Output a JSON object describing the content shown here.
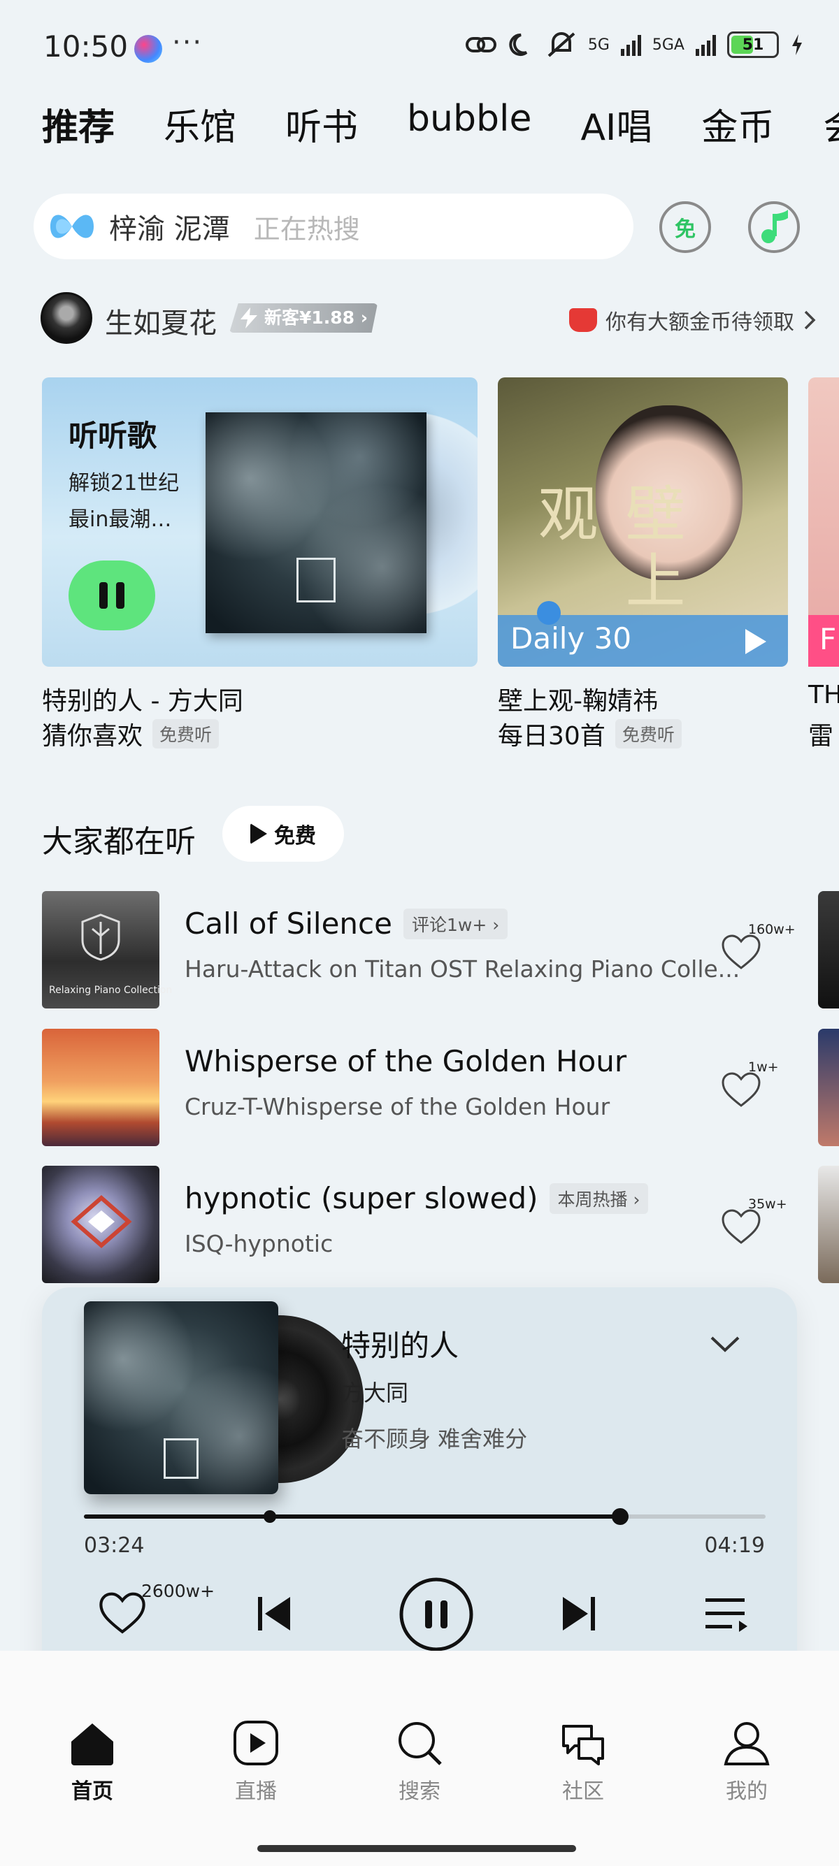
{
  "status_bar": {
    "time": "10:50",
    "dots": "···",
    "network1": "5G",
    "network2": "5GA",
    "battery": "51"
  },
  "tabs": [
    "推荐",
    "乐馆",
    "听书",
    "bubble",
    "AI唱",
    "金币",
    "会"
  ],
  "search": {
    "keyword": "梓渝 泥潭",
    "placeholder": "正在热搜",
    "free_badge": "免"
  },
  "user": {
    "name": "生如夏花",
    "promo": "新客¥1.88 ›",
    "coins_text": "你有大额金币待领取"
  },
  "cards": [
    {
      "heading": "听听歌",
      "subtitle": "解锁21世纪最in最潮…",
      "title": "特别的人 - 方大同",
      "caption": "猜你喜欢",
      "tag": "免费听"
    },
    {
      "overlay": "Daily 30",
      "cover_text": "壁上观",
      "title": "壁上观-鞠婧祎",
      "caption": "每日30首",
      "tag": "免费听"
    },
    {
      "overlay": "F",
      "title": "TH",
      "caption": "雷"
    }
  ],
  "section": {
    "title": "大家都在听",
    "free_chip": "免费"
  },
  "songs": [
    {
      "title": "Call of Silence",
      "tag": "评论1w+ ›",
      "sub": "Haru-Attack on Titan OST Relaxing Piano Colle...",
      "likes": "160w+",
      "thumb_text": "Relaxing Piano Collection"
    },
    {
      "title": "Whisperse of the Golden Hour",
      "tag": "",
      "sub": "Cruz-T-Whisperse of the Golden Hour",
      "likes": "1w+"
    },
    {
      "title": "hypnotic (super slowed)",
      "tag": "本周热播 ›",
      "sub": "ISQ-hypnotic",
      "likes": "35w+"
    }
  ],
  "player": {
    "title": "特别的人",
    "artist": "方大同",
    "lyric": "奋不顾身 难舍难分",
    "elapsed": "03:24",
    "duration": "04:19",
    "progress_fraction": 0.787,
    "buffered_fraction": 0.273,
    "likes": "2600w+"
  },
  "bottom_nav": [
    "首页",
    "直播",
    "搜索",
    "社区",
    "我的"
  ],
  "colors": {
    "accent_green": "#3ddc7a",
    "play_green": "#5ee47d",
    "daily_blue": "#4a96dc"
  }
}
